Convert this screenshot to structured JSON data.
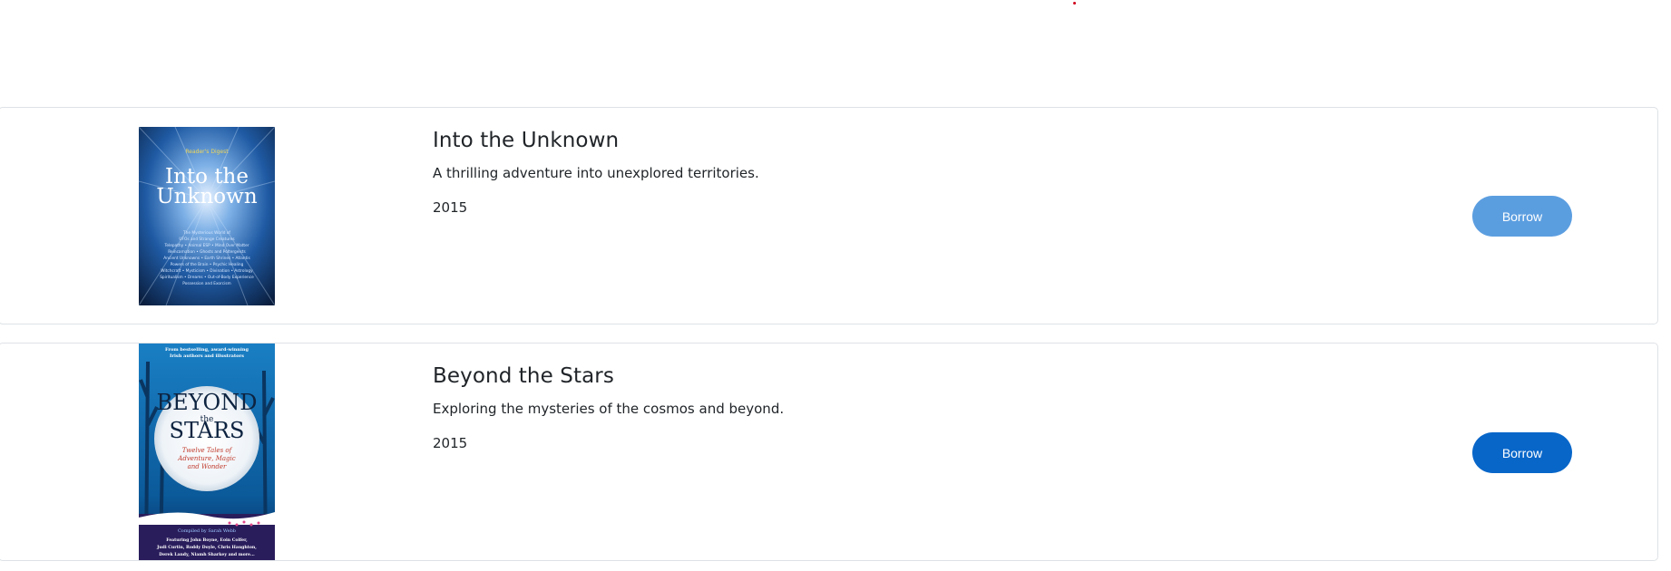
{
  "books": [
    {
      "title": "Into the Unknown",
      "description": "A thrilling adventure into unexplored territories.",
      "year": "2015",
      "borrow_label": "Borrow",
      "cover": {
        "publisher": "Reader's Digest",
        "line1": "Into the",
        "line2": "Unknown",
        "blurb": [
          "The Mysterious World of",
          "UFOs and Strange Creatures",
          "Telepathy • Animal ESP • Mind Over Matter",
          "Reincarnation • Ghosts and Poltergeists",
          "Ancient Unknowns • Earth Shrines • Atlantis",
          "Powers of the Brain • Psychic Healing",
          "Witchcraft • Mysticism • Divination • Astrology",
          "Spiritualism • Dreams • Out-of-Body Experience",
          "Possession and Exorcism"
        ]
      }
    },
    {
      "title": "Beyond the Stars",
      "description": "Exploring the mysteries of the cosmos and beyond.",
      "year": "2015",
      "borrow_label": "Borrow",
      "cover": {
        "top_line1": "From bestselling, award-winning",
        "top_line2": "Irish authors and illustrators",
        "word1": "BEYOND",
        "word2": "the",
        "word3": "STARS",
        "sub1": "Twelve Tales of",
        "sub2": "Adventure, Magic",
        "sub3": "and Wonder",
        "compiled": "Compiled by Sarah Webb",
        "featuring1": "Featuring John Boyne, Eoin Colfer,",
        "featuring2": "Judi Curtin, Roddy Doyle, Chris Haughton,",
        "featuring3": "Derek Landy, Niamh Sharkey and more..."
      }
    }
  ]
}
